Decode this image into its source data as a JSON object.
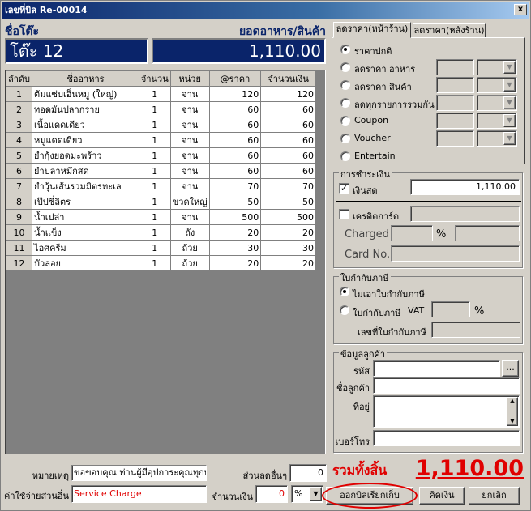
{
  "window": {
    "title": "เลขที่บิล Re-00014",
    "close": "x"
  },
  "table_label": "ชื่อโต๊ะ",
  "table_name": "โต๊ะ 12",
  "food_total_label": "ยอดอาหาร/สินค้า",
  "food_total": "1,110.00",
  "grid": {
    "columns": [
      "ลำดับ",
      "ชื่ออาหาร",
      "จำนวน",
      "หน่วย",
      "@ราคา",
      "จำนวนเงิน"
    ],
    "rows": [
      [
        "1",
        "ต้มแซ่บเอ็นหมู (ใหญ่)",
        "1",
        "จาน",
        "120",
        "120"
      ],
      [
        "2",
        "ทอดมันปลากราย",
        "1",
        "จาน",
        "60",
        "60"
      ],
      [
        "3",
        "เนื้อแดดเดียว",
        "1",
        "จาน",
        "60",
        "60"
      ],
      [
        "4",
        "หมูแดดเดียว",
        "1",
        "จาน",
        "60",
        "60"
      ],
      [
        "5",
        "ยำกุ้งยอดมะพร้าว",
        "1",
        "จาน",
        "60",
        "60"
      ],
      [
        "6",
        "ยำปลาหมึกสด",
        "1",
        "จาน",
        "60",
        "60"
      ],
      [
        "7",
        "ยำวุ้นเส้นรวมมิตรทะเล",
        "1",
        "จาน",
        "70",
        "70"
      ],
      [
        "8",
        "เป๊ปซี่ลิตร",
        "1",
        "ขวดใหญ่",
        "50",
        "50"
      ],
      [
        "9",
        "น้ำเปล่า",
        "1",
        "จาน",
        "500",
        "500"
      ],
      [
        "10",
        "น้ำแข็ง",
        "1",
        "ถัง",
        "20",
        "20"
      ],
      [
        "11",
        "ไอศครีม",
        "1",
        "ถ้วย",
        "30",
        "30"
      ],
      [
        "12",
        "บัวลอย",
        "1",
        "ถ้วย",
        "20",
        "20"
      ]
    ]
  },
  "tabs": {
    "front": "ลดราคา(หน้าร้าน)",
    "back": "ลดราคา(หลังร้าน)"
  },
  "discount_options": [
    "ราคาปกติ",
    "ลดราคา อาหาร",
    "ลดราคา สินค้า",
    "ลดทุกรายการรวมกัน",
    "Coupon",
    "Voucher",
    "Entertain"
  ],
  "payment": {
    "title": "การชำระเงิน",
    "cash_label": "เงินสด",
    "cash_value": "1,110.00",
    "credit_label": "เครดิตการ์ด",
    "charged_label": "Charged",
    "percent": "%",
    "card_no_label": "Card No."
  },
  "tax": {
    "title": "ใบกำกับภาษี",
    "no_invoice": "ไม่เอาใบกำกับภาษี",
    "invoice": "ใบกำกับภาษี",
    "vat_label": "VAT",
    "percent": "%",
    "invoice_no_label": "เลขที่ใบกำกับภาษี"
  },
  "customer": {
    "title": "ข้อมูลลูกค้า",
    "code_label": "รหัส",
    "browse": "...",
    "name_label": "ชื่อลูกค้า",
    "address_label": "ที่อยู่",
    "phone_label": "เบอร์โทร"
  },
  "bottom": {
    "note_label": "หมายเหตุ",
    "note_value": "ขอขอบคุณ ท่านผู้มีอุปการะคุณทุกท่า",
    "other_cost_label": "ค่าใช้จ่ายส่วนอื่น",
    "other_cost_value": "Service Charge",
    "other_discount_label": "ส่วนลดอื่นๆ",
    "other_discount_value": "0",
    "amount_label": "จำนวนเงิน",
    "amount_value": "0",
    "unit_value": "%",
    "grand_total_label": "รวมทั้งสิ้น",
    "grand_total": "1,110.00",
    "btn_print_bill": "ออกบิลเรียกเก็บ",
    "btn_pay": "คิดเงิน",
    "btn_cancel": "ยกเลิก"
  }
}
